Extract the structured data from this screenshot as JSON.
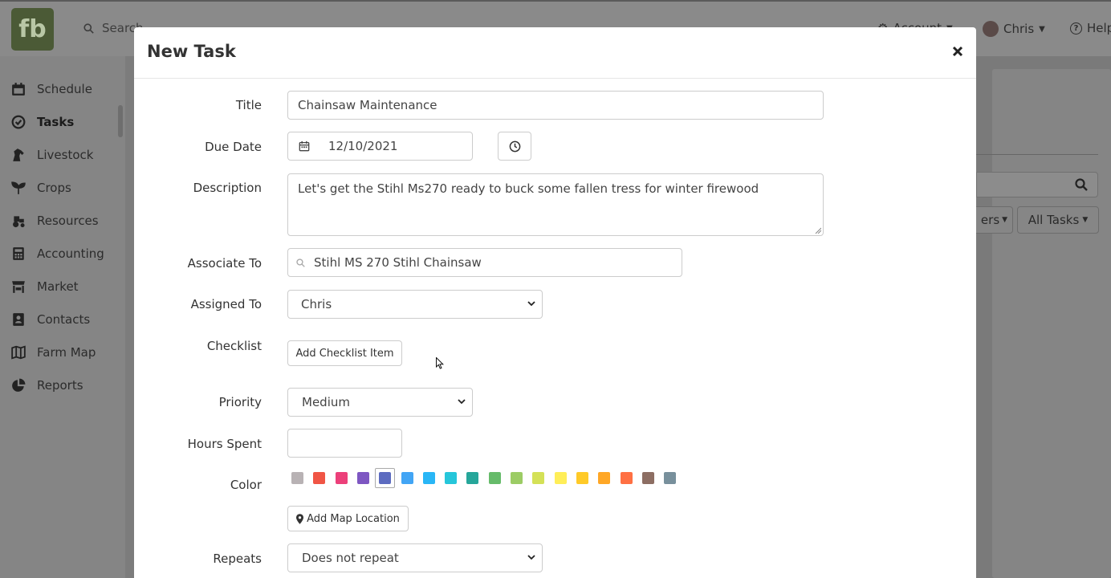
{
  "app": {
    "logo_text": "fb",
    "search_placeholder": "Search...",
    "account_label": "Account",
    "user_name": "Chris",
    "help_label": "Help"
  },
  "sidebar": {
    "items": [
      {
        "label": "Schedule",
        "icon": "calendar-icon"
      },
      {
        "label": "Tasks",
        "icon": "check-circle-icon",
        "active": true
      },
      {
        "label": "Livestock",
        "icon": "horse-icon"
      },
      {
        "label": "Crops",
        "icon": "seedling-icon"
      },
      {
        "label": "Resources",
        "icon": "tractor-icon"
      },
      {
        "label": "Accounting",
        "icon": "calculator-icon"
      },
      {
        "label": "Market",
        "icon": "store-icon"
      },
      {
        "label": "Contacts",
        "icon": "address-book-icon"
      },
      {
        "label": "Farm Map",
        "icon": "map-icon"
      },
      {
        "label": "Reports",
        "icon": "pie-chart-icon"
      }
    ]
  },
  "background": {
    "filters_label": "ers",
    "all_tasks_label": "All Tasks"
  },
  "modal": {
    "title": "New Task",
    "fields": {
      "title": {
        "label": "Title",
        "value": "Chainsaw Maintenance"
      },
      "due_date": {
        "label": "Due Date",
        "value": "12/10/2021"
      },
      "description": {
        "label": "Description",
        "value": "Let's get the Stihl Ms270 ready to buck some fallen tress for winter firewood"
      },
      "associate_to": {
        "label": "Associate To",
        "value": "Stihl MS 270 Stihl Chainsaw"
      },
      "assigned_to": {
        "label": "Assigned To",
        "value": "Chris"
      },
      "checklist": {
        "label": "Checklist",
        "button": "Add Checklist Item"
      },
      "priority": {
        "label": "Priority",
        "value": "Medium"
      },
      "hours_spent": {
        "label": "Hours Spent",
        "value": ""
      },
      "color": {
        "label": "Color",
        "options": [
          "#b8b2b4",
          "#f05545",
          "#ec407a",
          "#7e57c2",
          "#5c6bc0",
          "#42a5f5",
          "#29b6f6",
          "#26c6da",
          "#26a69a",
          "#66bb6a",
          "#9ccc65",
          "#d4e157",
          "#ffee58",
          "#ffca28",
          "#ffa726",
          "#ff7043",
          "#8d6e63",
          "#78909c"
        ],
        "selected_index": 4
      },
      "map_location": {
        "button": "Add Map Location"
      },
      "repeats": {
        "label": "Repeats",
        "value": "Does not repeat"
      }
    }
  }
}
